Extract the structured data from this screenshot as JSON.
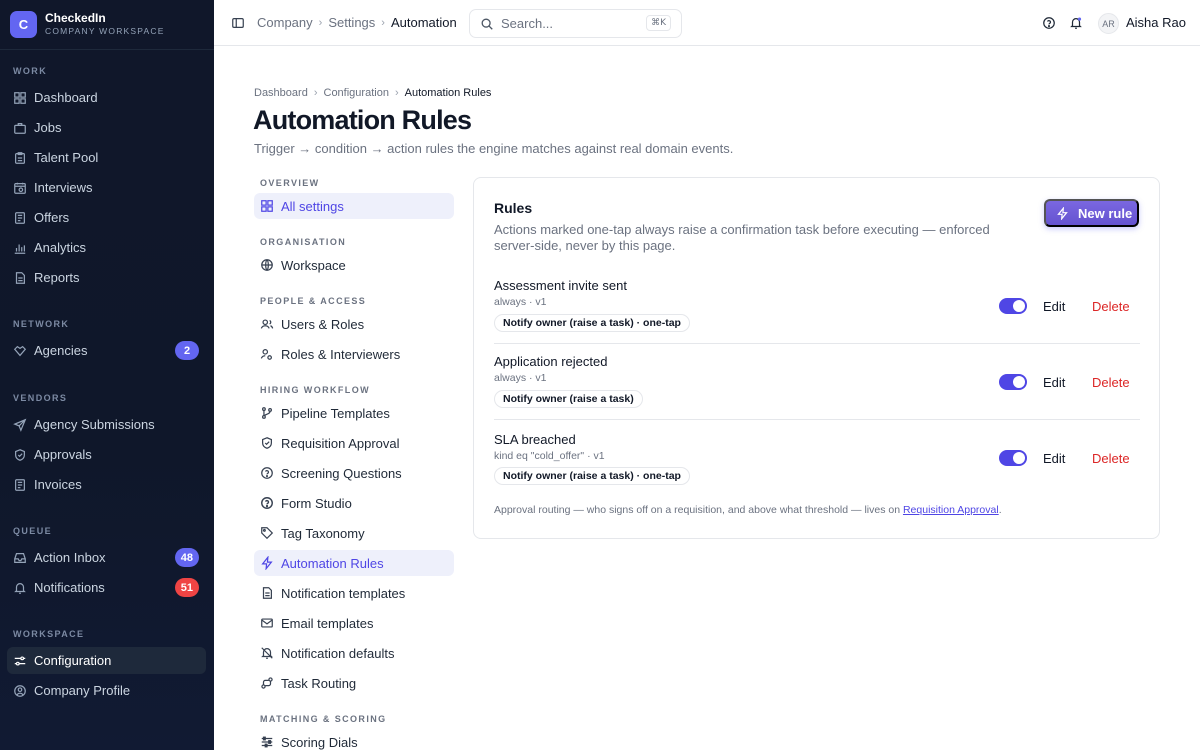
{
  "brand": {
    "logo_letter": "C",
    "name": "CheckedIn",
    "subtitle": "COMPANY WORKSPACE"
  },
  "sidebar": {
    "sections": [
      {
        "label": "WORK",
        "items": [
          {
            "label": "Dashboard",
            "icon": "grid-icon"
          },
          {
            "label": "Jobs",
            "icon": "briefcase-icon"
          },
          {
            "label": "Talent Pool",
            "icon": "clipboard-icon"
          },
          {
            "label": "Interviews",
            "icon": "calendar-icon"
          },
          {
            "label": "Offers",
            "icon": "document-icon"
          },
          {
            "label": "Analytics",
            "icon": "chart-icon"
          },
          {
            "label": "Reports",
            "icon": "report-icon"
          }
        ]
      },
      {
        "label": "NETWORK",
        "items": [
          {
            "label": "Agencies",
            "icon": "handshake-icon",
            "badge": "2"
          }
        ]
      },
      {
        "label": "VENDORS",
        "items": [
          {
            "label": "Agency Submissions",
            "icon": "send-icon"
          },
          {
            "label": "Approvals",
            "icon": "shield-icon"
          },
          {
            "label": "Invoices",
            "icon": "receipt-icon"
          }
        ]
      },
      {
        "label": "QUEUE",
        "items": [
          {
            "label": "Action Inbox",
            "icon": "inbox-icon",
            "badge": "48"
          },
          {
            "label": "Notifications",
            "icon": "bell-icon",
            "badge": "51"
          }
        ]
      },
      {
        "label": "WORKSPACE",
        "items": [
          {
            "label": "Configuration",
            "icon": "sliders-icon",
            "active": true
          },
          {
            "label": "Company Profile",
            "icon": "user-circle-icon"
          }
        ]
      }
    ]
  },
  "topbar": {
    "breadcrumb": [
      "Company",
      "Settings",
      "Automation"
    ],
    "search_placeholder": "Search...",
    "search_shortcut": "⌘K",
    "user_initials": "AR",
    "user_name": "Aisha Rao"
  },
  "page": {
    "breadcrumb": [
      "Dashboard",
      "Configuration",
      "Automation Rules"
    ],
    "title": "Automation Rules",
    "subtitle": "Trigger → condition → action rules the engine matches against real domain events."
  },
  "settings_nav": {
    "sections": [
      {
        "label": "OVERVIEW",
        "items": [
          {
            "label": "All settings",
            "icon": "grid-icon",
            "active": true
          }
        ]
      },
      {
        "label": "ORGANISATION",
        "items": [
          {
            "label": "Workspace",
            "icon": "globe-icon"
          }
        ]
      },
      {
        "label": "PEOPLE & ACCESS",
        "items": [
          {
            "label": "Users & Roles",
            "icon": "users-icon"
          },
          {
            "label": "Roles & Interviewers",
            "icon": "user-key-icon"
          }
        ]
      },
      {
        "label": "HIRING WORKFLOW",
        "items": [
          {
            "label": "Pipeline Templates",
            "icon": "branch-icon"
          },
          {
            "label": "Requisition Approval",
            "icon": "shield-check-icon"
          },
          {
            "label": "Screening Questions",
            "icon": "question-circle-icon"
          },
          {
            "label": "Form Studio",
            "icon": "help-circle-icon"
          },
          {
            "label": "Tag Taxonomy",
            "icon": "tag-icon"
          },
          {
            "label": "Automation Rules",
            "icon": "bolt-icon",
            "active": true
          },
          {
            "label": "Notification templates",
            "icon": "file-text-icon"
          },
          {
            "label": "Email templates",
            "icon": "mail-icon"
          },
          {
            "label": "Notification defaults",
            "icon": "bell-off-icon"
          },
          {
            "label": "Task Routing",
            "icon": "route-icon"
          }
        ]
      },
      {
        "label": "MATCHING & SCORING",
        "items": [
          {
            "label": "Scoring Dials",
            "icon": "dials-icon"
          }
        ]
      }
    ]
  },
  "rules_card": {
    "title": "Rules",
    "description": "Actions marked one-tap always raise a confirmation task before executing — enforced server-side, never by this page.",
    "new_rule_label": "New rule",
    "edit_label": "Edit",
    "delete_label": "Delete",
    "rules": [
      {
        "name": "Assessment invite sent",
        "meta": "always · v1",
        "action": "Notify owner (raise a task) · one-tap",
        "enabled": true
      },
      {
        "name": "Application rejected",
        "meta": "always · v1",
        "action": "Notify owner (raise a task)",
        "enabled": true
      },
      {
        "name": "SLA breached",
        "meta": "kind eq \"cold_offer\" · v1",
        "action": "Notify owner (raise a task) · one-tap",
        "enabled": true
      }
    ],
    "footer_text": "Approval routing — who signs off on a requisition, and above what threshold — lives on ",
    "footer_link": "Requisition Approval",
    "footer_end": "."
  }
}
